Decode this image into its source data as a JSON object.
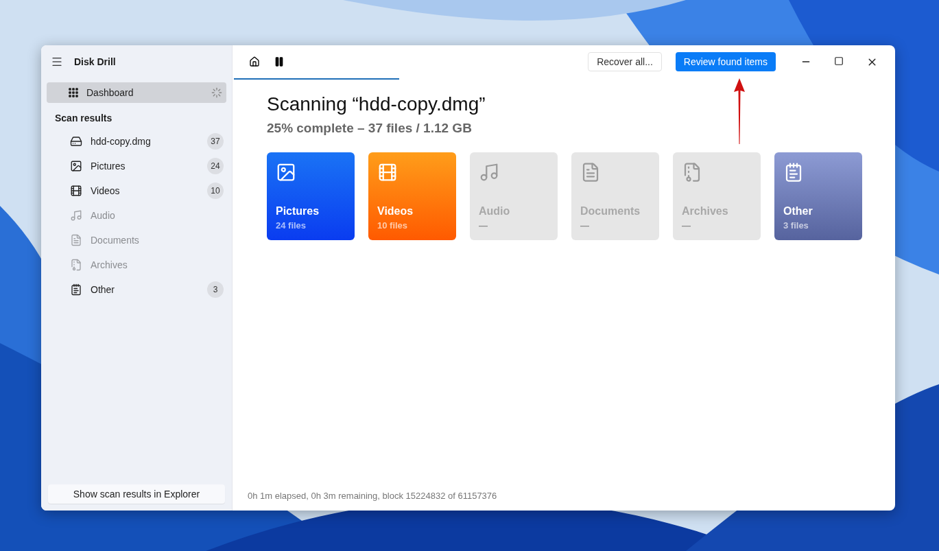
{
  "app": {
    "title": "Disk Drill"
  },
  "sidebar": {
    "dashboard": {
      "label": "Dashboard",
      "selected": true,
      "busy": true
    },
    "section_title": "Scan results",
    "items": [
      {
        "label": "hdd-copy.dmg",
        "kind": "drive",
        "count": "37",
        "disabled": false,
        "selected": false
      },
      {
        "label": "Pictures",
        "kind": "pictures",
        "count": "24",
        "disabled": false,
        "selected": false
      },
      {
        "label": "Videos",
        "kind": "videos",
        "count": "10",
        "disabled": false,
        "selected": false
      },
      {
        "label": "Audio",
        "kind": "audio",
        "disabled": true,
        "selected": false
      },
      {
        "label": "Documents",
        "kind": "documents",
        "disabled": true,
        "selected": false
      },
      {
        "label": "Archives",
        "kind": "archives",
        "disabled": true,
        "selected": false
      },
      {
        "label": "Other",
        "kind": "other",
        "count": "3",
        "disabled": false,
        "selected": false
      }
    ],
    "footer_button": "Show scan results in Explorer"
  },
  "toolbar": {
    "progress": {
      "level": 0.25
    },
    "buttons": [
      "Recover all...",
      "Review found items"
    ]
  },
  "main": {
    "title": "Scanning “hdd-copy.dmg”",
    "subtitle": "25% complete – 37 files / 1.12 GB",
    "cards": [
      {
        "title": "Pictures",
        "subtitle": "24 files",
        "kind": "pictures",
        "disabled": false
      },
      {
        "title": "Videos",
        "subtitle": "10 files",
        "kind": "videos",
        "disabled": false
      },
      {
        "title": "Audio",
        "subtitle": "—",
        "kind": "audio",
        "disabled": true
      },
      {
        "title": "Documents",
        "subtitle": "—",
        "kind": "documents",
        "disabled": true
      },
      {
        "title": "Archives",
        "subtitle": "—",
        "kind": "archives",
        "disabled": true
      },
      {
        "title": "Other",
        "subtitle": "3 files",
        "kind": "other",
        "disabled": false
      }
    ],
    "status": "0h 1m elapsed, 0h 3m remaining, block 15224832 of 61157376"
  }
}
